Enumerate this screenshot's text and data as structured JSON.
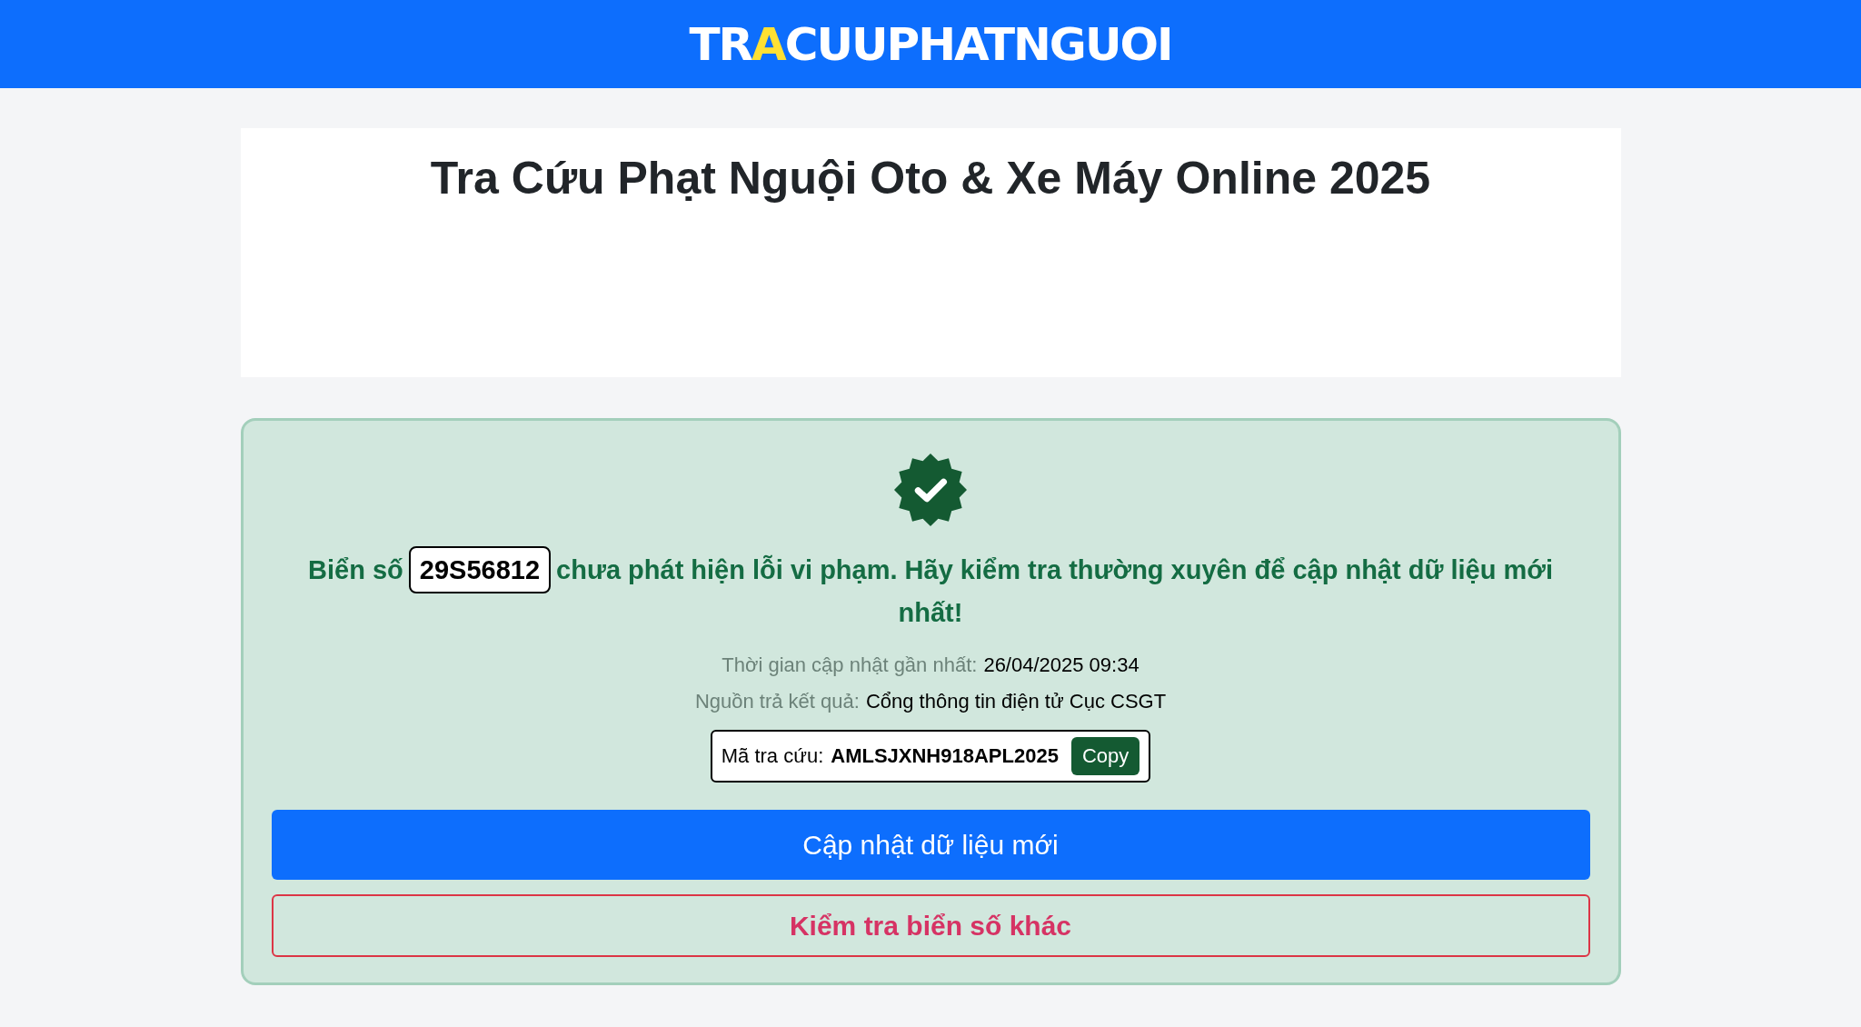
{
  "header": {
    "logo": [
      {
        "text": "TR",
        "color": "#ffffff"
      },
      {
        "text": "A",
        "color": "#ffe033"
      },
      {
        "text": "CUUPHATNGUOI",
        "color": "#ffffff"
      }
    ]
  },
  "title_card": {
    "title": "Tra Cứu Phạt Nguội Oto & Xe Máy Online 2025"
  },
  "result": {
    "message_before": "Biển số",
    "plate": "29S56812",
    "message_after": "chưa phát hiện lỗi vi phạm. Hãy kiểm tra thường xuyên để cập nhật dữ liệu mới nhất!",
    "info": [
      {
        "label": "Thời gian cập nhật gần nhất:",
        "value": "26/04/2025 09:34"
      },
      {
        "label": "Nguồn trả kết quả:",
        "value": "Cổng thông tin điện tử Cục CSGT"
      }
    ],
    "code": {
      "label": "Mã tra cứu:",
      "value": "AMLSJXNH918APL2025",
      "button": "Copy"
    },
    "buttons": [
      {
        "label": "Cập nhật dữ liệu mới",
        "kind": "primary"
      },
      {
        "label": "Kiểm tra biển số khác",
        "kind": "outline"
      }
    ]
  }
}
